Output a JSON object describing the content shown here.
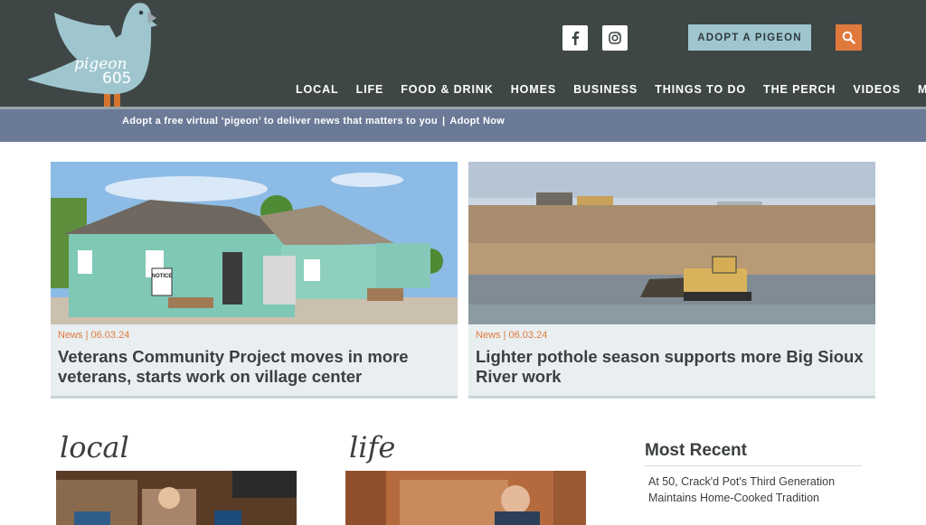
{
  "logo": {
    "line1": "pigeon",
    "line2": "605"
  },
  "header": {
    "adopt_button": "ADOPT A PIGEON",
    "nav": [
      "LOCAL",
      "LIFE",
      "FOOD & DRINK",
      "HOMES",
      "BUSINESS",
      "THINGS TO DO",
      "THE PERCH",
      "VIDEOS",
      "MORE"
    ]
  },
  "banner": {
    "text": "Adopt a free virtual ‘pigeon’ to deliver news that matters to you",
    "separator": "|",
    "link": "Adopt Now"
  },
  "featured": [
    {
      "category": "News",
      "date": "06.03.24",
      "title": "Veterans Community Project moves in more veterans, starts work on village center",
      "sign": "NOTICE"
    },
    {
      "category": "News",
      "date": "06.03.24",
      "title": "Lighter pothole season supports more Big Sioux River work"
    }
  ],
  "sections": {
    "local": "local",
    "life": "life"
  },
  "most_recent": {
    "title": "Most Recent",
    "items": [
      "At 50, Crack'd Pot's Third Generation Maintains Home-Cooked Tradition"
    ]
  },
  "colors": {
    "header": "#3f4646",
    "banner": "#6a7a97",
    "accent": "#e07a3c",
    "adopt": "#9fc6cf"
  }
}
